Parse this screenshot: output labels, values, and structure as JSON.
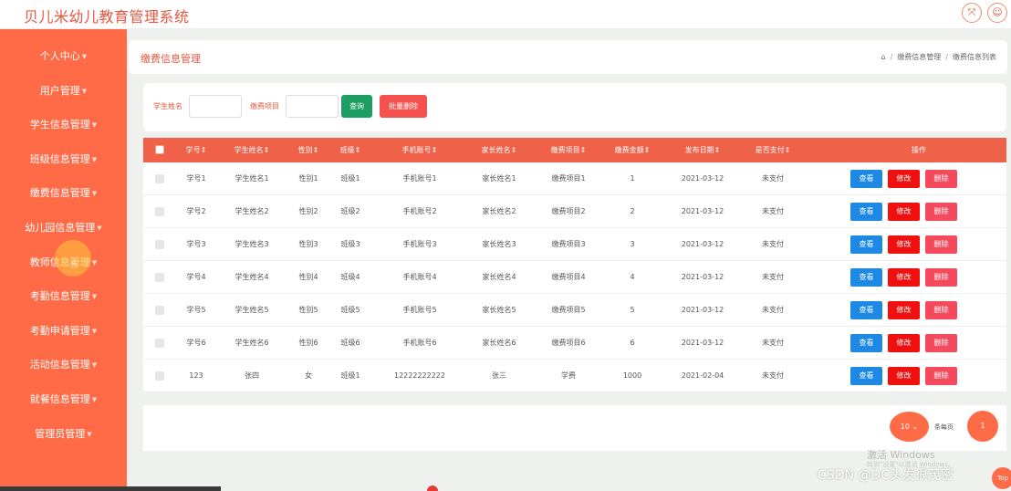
{
  "app": {
    "title": "贝儿米幼儿教育管理系统"
  },
  "icons": {
    "fullscreen": "fullscreen-icon",
    "user": "user-icon",
    "home": "home-icon"
  },
  "colors": {
    "accent": "#ff6b47",
    "header": "#f0614a",
    "view": "#1e88e5",
    "edit": "#f01010",
    "delete": "#f44a5c",
    "query": "#1d9f63"
  },
  "sidebar": {
    "items": [
      {
        "label": "个人中心"
      },
      {
        "label": "用户管理"
      },
      {
        "label": "学生信息管理"
      },
      {
        "label": "班级信息管理"
      },
      {
        "label": "缴费信息管理"
      },
      {
        "label": "幼儿园信息管理"
      },
      {
        "label": "教师信息管理"
      },
      {
        "label": "考勤信息管理"
      },
      {
        "label": "考勤申请管理"
      },
      {
        "label": "活动信息管理"
      },
      {
        "label": "就餐信息管理"
      },
      {
        "label": "管理员管理"
      }
    ]
  },
  "header": {
    "title": "缴费信息管理",
    "breadcrumb": [
      "缴费信息管理",
      "缴费信息列表"
    ]
  },
  "search": {
    "student_label": "学生姓名",
    "item_label": "缴费项目",
    "query_label": "查询",
    "bulk_delete_label": "批量删除"
  },
  "table": {
    "columns": [
      "学号",
      "学生姓名",
      "性别",
      "班级",
      "手机账号",
      "家长姓名",
      "缴费项目",
      "缴费金额",
      "发布日期",
      "是否支付",
      "操作"
    ],
    "sort_mark": "⇕",
    "rows": [
      [
        "学号1",
        "学生姓名1",
        "性别1",
        "班级1",
        "手机账号1",
        "家长姓名1",
        "缴费项目1",
        "1",
        "2021-03-12",
        "未支付"
      ],
      [
        "学号2",
        "学生姓名2",
        "性别2",
        "班级2",
        "手机账号2",
        "家长姓名2",
        "缴费项目2",
        "2",
        "2021-03-12",
        "未支付"
      ],
      [
        "学号3",
        "学生姓名3",
        "性别3",
        "班级3",
        "手机账号3",
        "家长姓名3",
        "缴费项目3",
        "3",
        "2021-03-12",
        "未支付"
      ],
      [
        "学号4",
        "学生姓名4",
        "性别4",
        "班级4",
        "手机账号4",
        "家长姓名4",
        "缴费项目4",
        "4",
        "2021-03-12",
        "未支付"
      ],
      [
        "学号5",
        "学生姓名5",
        "性别5",
        "班级5",
        "手机账号5",
        "家长姓名5",
        "缴费项目5",
        "5",
        "2021-03-12",
        "未支付"
      ],
      [
        "学号6",
        "学生姓名6",
        "性别6",
        "班级6",
        "手机账号6",
        "家长姓名6",
        "缴费项目6",
        "6",
        "2021-03-12",
        "未支付"
      ],
      [
        "123",
        "张四",
        "女",
        "班级1",
        "12222222222",
        "张三",
        "学费",
        "1000",
        "2021-02-04",
        "未支付"
      ]
    ],
    "actions": {
      "view": "查看",
      "edit": "修改",
      "delete": "删除"
    }
  },
  "pagination": {
    "page_size": "10",
    "page_size_suffix": "条每页",
    "current_page": "1"
  },
  "overlay": {
    "activate": "激活 Windows",
    "activate_sub": "转到\"设置\"以激活 Windows。",
    "watermark": "CSDN @DC头发很茂密",
    "top_button": "Top"
  }
}
